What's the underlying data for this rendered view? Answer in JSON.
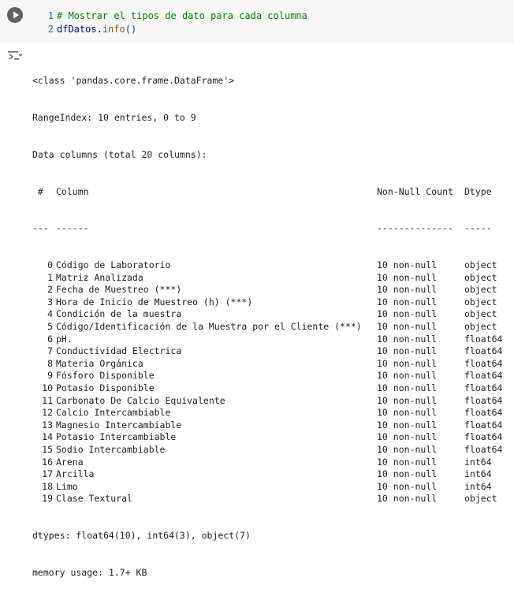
{
  "code_cell": {
    "lines": [
      {
        "number": "1",
        "comment": "# Mostrar el tipos de dato para cada columna"
      },
      {
        "number": "2",
        "object": "dfDatos",
        "dot": ".",
        "method": "info",
        "parens": "()"
      }
    ]
  },
  "output": {
    "class_line": "<class 'pandas.core.frame.DataFrame'>",
    "range_index": "RangeIndex: 10 entries, 0 to 9",
    "data_columns": "Data columns (total 20 columns):",
    "header": {
      "idx": " #",
      "column": "Column",
      "count": "Non-Null Count",
      "dtype": "Dtype"
    },
    "separator": {
      "idx": "---",
      "column": "------",
      "count": "--------------",
      "dtype": "-----"
    },
    "rows": [
      {
        "idx": "0",
        "column": "Código de Laboratorio",
        "count": "10 non-null",
        "dtype": "object"
      },
      {
        "idx": "1",
        "column": "Matriz Analizada",
        "count": "10 non-null",
        "dtype": "object"
      },
      {
        "idx": "2",
        "column": "Fecha de Muestreo (***)",
        "count": "10 non-null",
        "dtype": "object"
      },
      {
        "idx": "3",
        "column": "Hora de Inicio de Muestreo (h) (***)",
        "count": "10 non-null",
        "dtype": "object"
      },
      {
        "idx": "4",
        "column": "Condición de la muestra",
        "count": "10 non-null",
        "dtype": "object"
      },
      {
        "idx": "5",
        "column": "Código/Identificación de la Muestra por el Cliente (***)",
        "count": "10 non-null",
        "dtype": "object"
      },
      {
        "idx": "6",
        "column": "pH.",
        "count": "10 non-null",
        "dtype": "float64"
      },
      {
        "idx": "7",
        "column": "Conductividad Electrica",
        "count": "10 non-null",
        "dtype": "float64"
      },
      {
        "idx": "8",
        "column": "Materia Orgánica",
        "count": "10 non-null",
        "dtype": "float64"
      },
      {
        "idx": "9",
        "column": "Fósforo Disponible",
        "count": "10 non-null",
        "dtype": "float64"
      },
      {
        "idx": "10",
        "column": "Potasio Disponible",
        "count": "10 non-null",
        "dtype": "float64"
      },
      {
        "idx": "11",
        "column": "Carbonato De Calcio Equivalente",
        "count": "10 non-null",
        "dtype": "float64"
      },
      {
        "idx": "12",
        "column": "Calcio Intercambiable",
        "count": "10 non-null",
        "dtype": "float64"
      },
      {
        "idx": "13",
        "column": "Magnesio Intercambiable",
        "count": "10 non-null",
        "dtype": "float64"
      },
      {
        "idx": "14",
        "column": "Potasio Intercambiable",
        "count": "10 non-null",
        "dtype": "float64"
      },
      {
        "idx": "15",
        "column": "Sodio Intercambiable",
        "count": "10 non-null",
        "dtype": "float64"
      },
      {
        "idx": "16",
        "column": "Arena",
        "count": "10 non-null",
        "dtype": "int64"
      },
      {
        "idx": "17",
        "column": "Arcilla",
        "count": "10 non-null",
        "dtype": "int64"
      },
      {
        "idx": "18",
        "column": "Limo",
        "count": "10 non-null",
        "dtype": "int64"
      },
      {
        "idx": "19",
        "column": "Clase Textural",
        "count": "10 non-null",
        "dtype": "object"
      }
    ],
    "dtypes_line": "dtypes: float64(10), int64(3), object(7)",
    "memory_line": "memory usage: 1.7+ KB"
  },
  "icons": {
    "run": "play-circle-icon",
    "output": "output-options-icon"
  },
  "colors": {
    "cell_background": "#f7f7f7",
    "line_number": "#237893",
    "comment": "#008000",
    "identifier": "#001080",
    "method": "#795e26",
    "bracket": "#0431fa",
    "run_button": "#5f6368",
    "output_text": "#212121"
  }
}
